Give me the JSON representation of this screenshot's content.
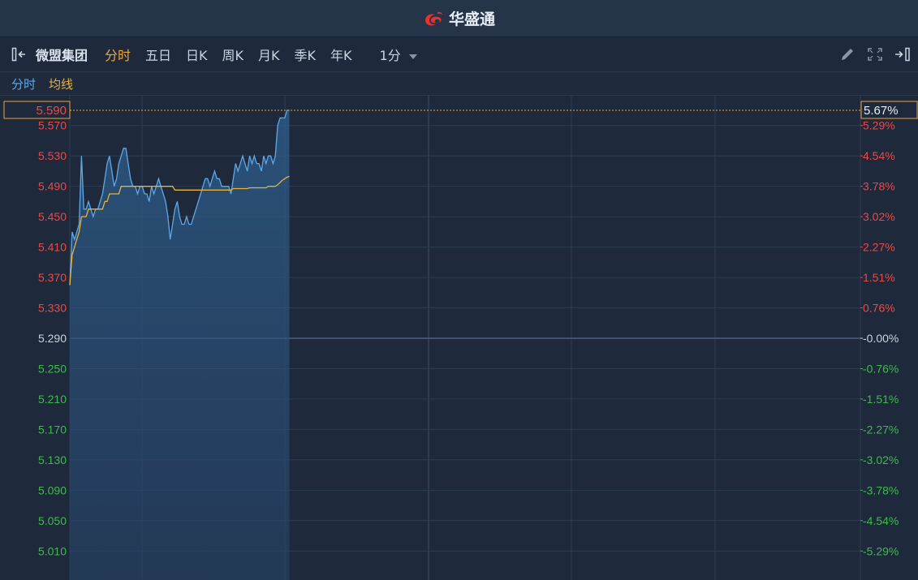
{
  "header": {
    "brand": "华盛通"
  },
  "toolbar": {
    "stock_name": "微盟集团",
    "tabs": [
      {
        "label": "分时",
        "active": true
      },
      {
        "label": "五日",
        "active": false
      },
      {
        "label": "日K",
        "active": false
      },
      {
        "label": "周K",
        "active": false
      },
      {
        "label": "月K",
        "active": false
      },
      {
        "label": "季K",
        "active": false
      },
      {
        "label": "年K",
        "active": false
      }
    ],
    "interval": "1分",
    "icons": [
      "collapse-left-icon",
      "pencil-icon",
      "fullscreen-icon",
      "expand-right-icon"
    ]
  },
  "legend": {
    "price_label": "分时",
    "avg_label": "均线"
  },
  "colors": {
    "price_line": "#5fa8e8",
    "avg_line": "#e8b23c",
    "up": "#e84a4a",
    "down": "#3dbb4a",
    "neutral": "#c9d3e0",
    "highlight": "#f2a33a",
    "grid": "#2d3c52",
    "baseline": "#4a5f7c"
  },
  "chart_data": {
    "type": "line",
    "prev_close": 5.29,
    "current_price_label": "5.590",
    "current_change_label": "5.67%",
    "ylim": [
      4.99,
      5.61
    ],
    "y_ticks": [
      {
        "price": "5.570",
        "pct": "5.29%",
        "value": 5.57
      },
      {
        "price": "5.530",
        "pct": "4.54%",
        "value": 5.53
      },
      {
        "price": "5.490",
        "pct": "3.78%",
        "value": 5.49
      },
      {
        "price": "5.450",
        "pct": "3.02%",
        "value": 5.45
      },
      {
        "price": "5.410",
        "pct": "2.27%",
        "value": 5.41
      },
      {
        "price": "5.370",
        "pct": "1.51%",
        "value": 5.37
      },
      {
        "price": "5.330",
        "pct": "0.76%",
        "value": 5.33
      },
      {
        "price": "5.290",
        "pct": "-0.00%",
        "value": 5.29
      },
      {
        "price": "5.250",
        "pct": "-0.76%",
        "value": 5.25
      },
      {
        "price": "5.210",
        "pct": "-1.51%",
        "value": 5.21
      },
      {
        "price": "5.170",
        "pct": "-2.27%",
        "value": 5.17
      },
      {
        "price": "5.130",
        "pct": "-3.02%",
        "value": 5.13
      },
      {
        "price": "5.090",
        "pct": "-3.78%",
        "value": 5.09
      },
      {
        "price": "5.050",
        "pct": "-4.54%",
        "value": 5.05
      },
      {
        "price": "5.010",
        "pct": "-5.29%",
        "value": 5.01
      }
    ],
    "total_minutes": 330,
    "series": [
      {
        "values": [
          5.36,
          5.43,
          5.42,
          5.43,
          5.44,
          5.53,
          5.46,
          5.46,
          5.47,
          5.46,
          5.45,
          5.46,
          5.46,
          5.47,
          5.48,
          5.5,
          5.52,
          5.53,
          5.51,
          5.49,
          5.5,
          5.52,
          5.53,
          5.54,
          5.54,
          5.52,
          5.5,
          5.49,
          5.49,
          5.48,
          5.49,
          5.49,
          5.48,
          5.48,
          5.47,
          5.49,
          5.48,
          5.49,
          5.5,
          5.49,
          5.48,
          5.47,
          5.45,
          5.42,
          5.44,
          5.46,
          5.47,
          5.45,
          5.44,
          5.44,
          5.45,
          5.44,
          5.44,
          5.45,
          5.46,
          5.47,
          5.48,
          5.49,
          5.5,
          5.5,
          5.49,
          5.5,
          5.51,
          5.5,
          5.5,
          5.49,
          5.49,
          5.49,
          5.49,
          5.48,
          5.5,
          5.52,
          5.51,
          5.52,
          5.53,
          5.52,
          5.51,
          5.53,
          5.52,
          5.53,
          5.52,
          5.52,
          5.51,
          5.53,
          5.52,
          5.53,
          5.53,
          5.52,
          5.53,
          5.57,
          5.58,
          5.58,
          5.58,
          5.59,
          5.59
        ]
      },
      {
        "values": [
          5.36,
          5.4,
          5.41,
          5.42,
          5.43,
          5.45,
          5.45,
          5.45,
          5.46,
          5.46,
          5.46,
          5.46,
          5.46,
          5.46,
          5.46,
          5.47,
          5.47,
          5.48,
          5.48,
          5.48,
          5.48,
          5.48,
          5.49,
          5.49,
          5.49,
          5.49,
          5.49,
          5.49,
          5.49,
          5.49,
          5.49,
          5.49,
          5.49,
          5.49,
          5.49,
          5.49,
          5.49,
          5.49,
          5.49,
          5.49,
          5.49,
          5.49,
          5.49,
          5.49,
          5.49,
          5.485,
          5.485,
          5.485,
          5.485,
          5.485,
          5.485,
          5.485,
          5.485,
          5.485,
          5.485,
          5.485,
          5.485,
          5.485,
          5.485,
          5.485,
          5.485,
          5.485,
          5.485,
          5.485,
          5.485,
          5.485,
          5.485,
          5.485,
          5.485,
          5.485,
          5.487,
          5.487,
          5.487,
          5.487,
          5.487,
          5.487,
          5.487,
          5.488,
          5.488,
          5.488,
          5.488,
          5.488,
          5.488,
          5.488,
          5.488,
          5.49,
          5.49,
          5.49,
          5.49,
          5.492,
          5.495,
          5.498,
          5.5,
          5.502,
          5.503
        ]
      }
    ]
  }
}
